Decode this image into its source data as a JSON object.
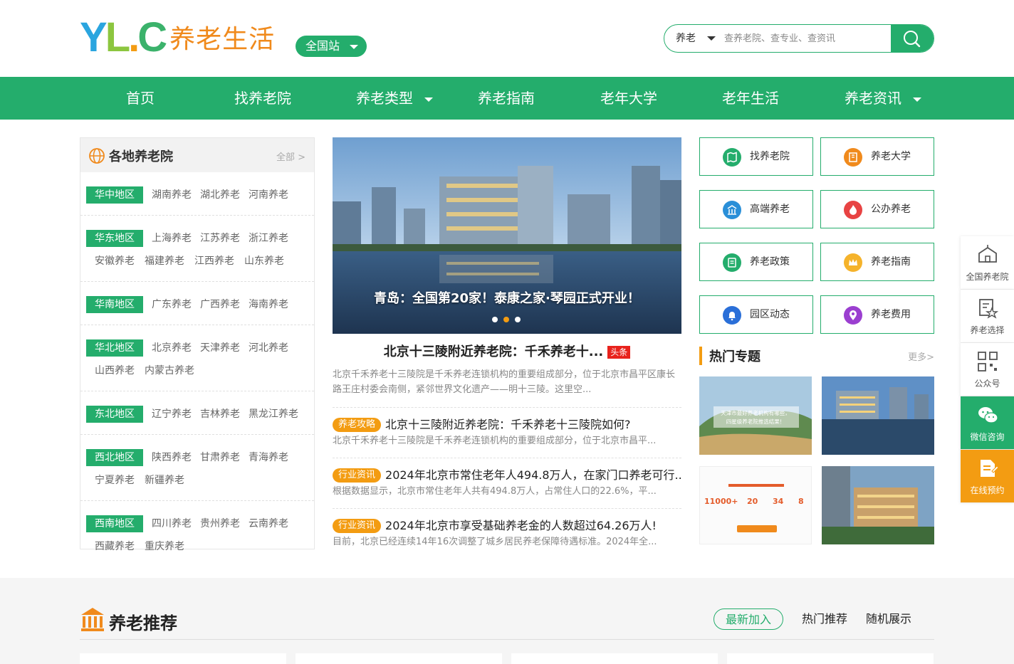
{
  "header": {
    "logo_name": "养老生活",
    "site_button": "全国站",
    "search": {
      "select_value": "养老",
      "placeholder": "查养老院、查专业、查资讯"
    }
  },
  "nav": [
    {
      "label": "首页"
    },
    {
      "label": "找养老院"
    },
    {
      "label": "养老类型"
    },
    {
      "label": "养老指南"
    },
    {
      "label": "老年大学"
    },
    {
      "label": "老年生活"
    },
    {
      "label": "养老资讯"
    }
  ],
  "regions_panel": {
    "title": "各地养老院",
    "all_link": "全部 >",
    "regions": [
      {
        "tag": "华中地区",
        "row1": [
          "湖南养老",
          "湖北养老",
          "河南养老"
        ],
        "row2": []
      },
      {
        "tag": "华东地区",
        "row1": [
          "上海养老",
          "江苏养老",
          "浙江养老"
        ],
        "row2": [
          "安徽养老",
          "福建养老",
          "江西养老",
          "山东养老"
        ]
      },
      {
        "tag": "华南地区",
        "row1": [
          "广东养老",
          "广西养老",
          "海南养老"
        ],
        "row2": []
      },
      {
        "tag": "华北地区",
        "row1": [
          "北京养老",
          "天津养老",
          "河北养老"
        ],
        "row2": [
          "山西养老",
          "内蒙古养老"
        ]
      },
      {
        "tag": "东北地区",
        "row1": [
          "辽宁养老",
          "吉林养老",
          "黑龙江养老"
        ],
        "row2": []
      },
      {
        "tag": "西北地区",
        "row1": [
          "陕西养老",
          "甘肃养老",
          "青海养老"
        ],
        "row2": [
          "宁夏养老",
          "新疆养老"
        ]
      },
      {
        "tag": "西南地区",
        "row1": [
          "四川养老",
          "贵州养老",
          "云南养老"
        ],
        "row2": [
          "西藏养老",
          "重庆养老"
        ]
      }
    ]
  },
  "carousel": {
    "caption": "青岛：全国第20家！泰康之家·琴园正式开业！",
    "active_dot": 2,
    "dot_count": 3
  },
  "headline": {
    "title": "北京十三陵附近养老院：千禾养老十...",
    "badge": "头条",
    "desc": "北京千禾养老十三陵院是千禾养老连锁机构的重要组成部分，位于北京市昌平区康长路王庄村委会南侧，紧邻世界文化遗产——明十三陵。这里空..."
  },
  "news": [
    {
      "tag": "养老攻略",
      "title": "北京十三陵附近养老院：千禾养老十三陵院如何?",
      "desc": "北京千禾养老十三陵院是千禾养老连锁机构的重要组成部分，位于北京市昌平..."
    },
    {
      "tag": "行业资讯",
      "title": "2024年北京市常住老年人494.8万人，在家门口养老可行...",
      "desc": "根据数据显示，北京市常住老年人共有494.8万人，占常住人口的22.6%，平..."
    },
    {
      "tag": "行业资讯",
      "title": "2024年北京市享受基础养老金的人数超过64.26万人!",
      "desc": "目前，北京已经连续14年16次调整了城乡居民养老保障待遇标准。2024年全..."
    }
  ],
  "quick_links": [
    {
      "label": "找养老院",
      "icon": "map-icon",
      "color": "#24ad6c"
    },
    {
      "label": "养老大学",
      "icon": "book-icon",
      "color": "#f08a1c"
    },
    {
      "label": "高端养老",
      "icon": "building-icon",
      "color": "#2a8fd8"
    },
    {
      "label": "公办养老",
      "icon": "flame-icon",
      "color": "#e84343"
    },
    {
      "label": "养老政策",
      "icon": "document-icon",
      "color": "#24ad6c"
    },
    {
      "label": "养老指南",
      "icon": "crown-icon",
      "color": "#f5b32b"
    },
    {
      "label": "园区动态",
      "icon": "bell-icon",
      "color": "#2a6fd8"
    },
    {
      "label": "养老费用",
      "icon": "location-icon",
      "color": "#9b3fd0"
    }
  ],
  "hot_topics": {
    "title": "热门专题",
    "more": "更多>",
    "thumb1_text": "天津市最好养老机构有哪些，四星级养老院推选结果！",
    "thumb3_numbers": [
      "11000+",
      "20",
      "34",
      "8"
    ]
  },
  "side_bar": [
    {
      "label": "全国养老院",
      "icon": "nursing-home-icon"
    },
    {
      "label": "养老选择",
      "icon": "checklist-icon"
    },
    {
      "label": "公众号",
      "icon": "qr-icon"
    },
    {
      "label": "微信咨询",
      "icon": "wechat-icon"
    },
    {
      "label": "在线预约",
      "icon": "edit-icon"
    }
  ],
  "recommend": {
    "title": "养老推荐",
    "tabs": [
      "最新加入",
      "热门推荐",
      "随机展示"
    ]
  },
  "colors": {
    "brand_green": "#24ad6c",
    "accent_orange": "#f39c12",
    "badge_red": "#e8221c"
  }
}
